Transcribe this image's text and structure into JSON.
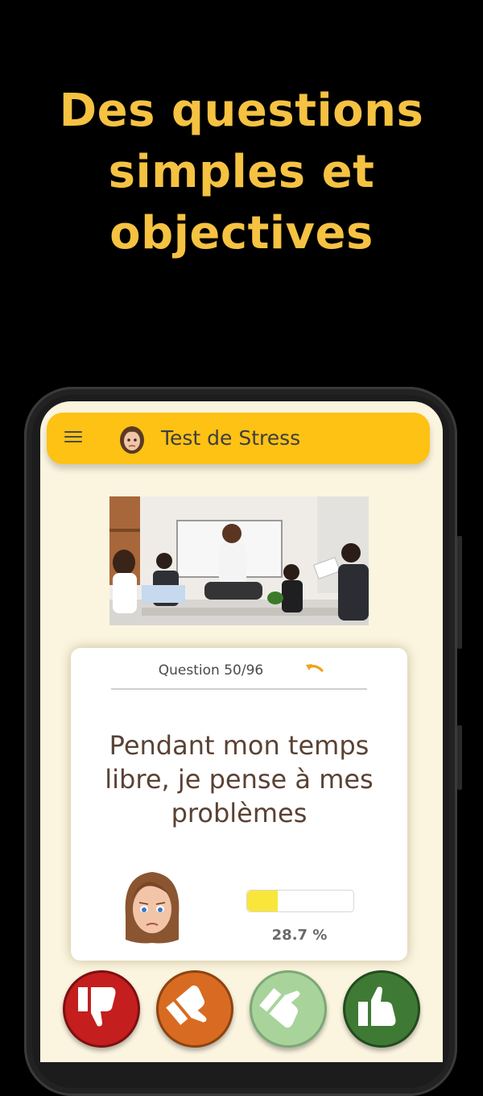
{
  "headline": {
    "line1": "Des questions",
    "line2": "simples et",
    "line3": "objectives"
  },
  "app": {
    "title": "Test de Stress",
    "menu_icon": "menu-icon"
  },
  "question": {
    "counter": "Question 50/96",
    "text": "Pendant mon temps libre, je pense à mes problèmes",
    "undo_icon": "undo-icon"
  },
  "progress": {
    "value": 0.287,
    "label": "28.7 %"
  },
  "answers": [
    {
      "name": "no",
      "icon": "thumbs-down-icon",
      "color": "#c41e1e"
    },
    {
      "name": "rather-no",
      "icon": "thumb-down-tilted-icon",
      "color": "#d86b21"
    },
    {
      "name": "rather-yes",
      "icon": "thumb-pointing-icon",
      "color": "#a8d49b"
    },
    {
      "name": "yes",
      "icon": "thumbs-up-icon",
      "color": "#3f7a35"
    }
  ],
  "colors": {
    "background": "#000000",
    "headline": "#f5c242",
    "app_bar": "#fdc214",
    "screen": "#fbf5e0",
    "progress_fill": "#f9e63a"
  }
}
